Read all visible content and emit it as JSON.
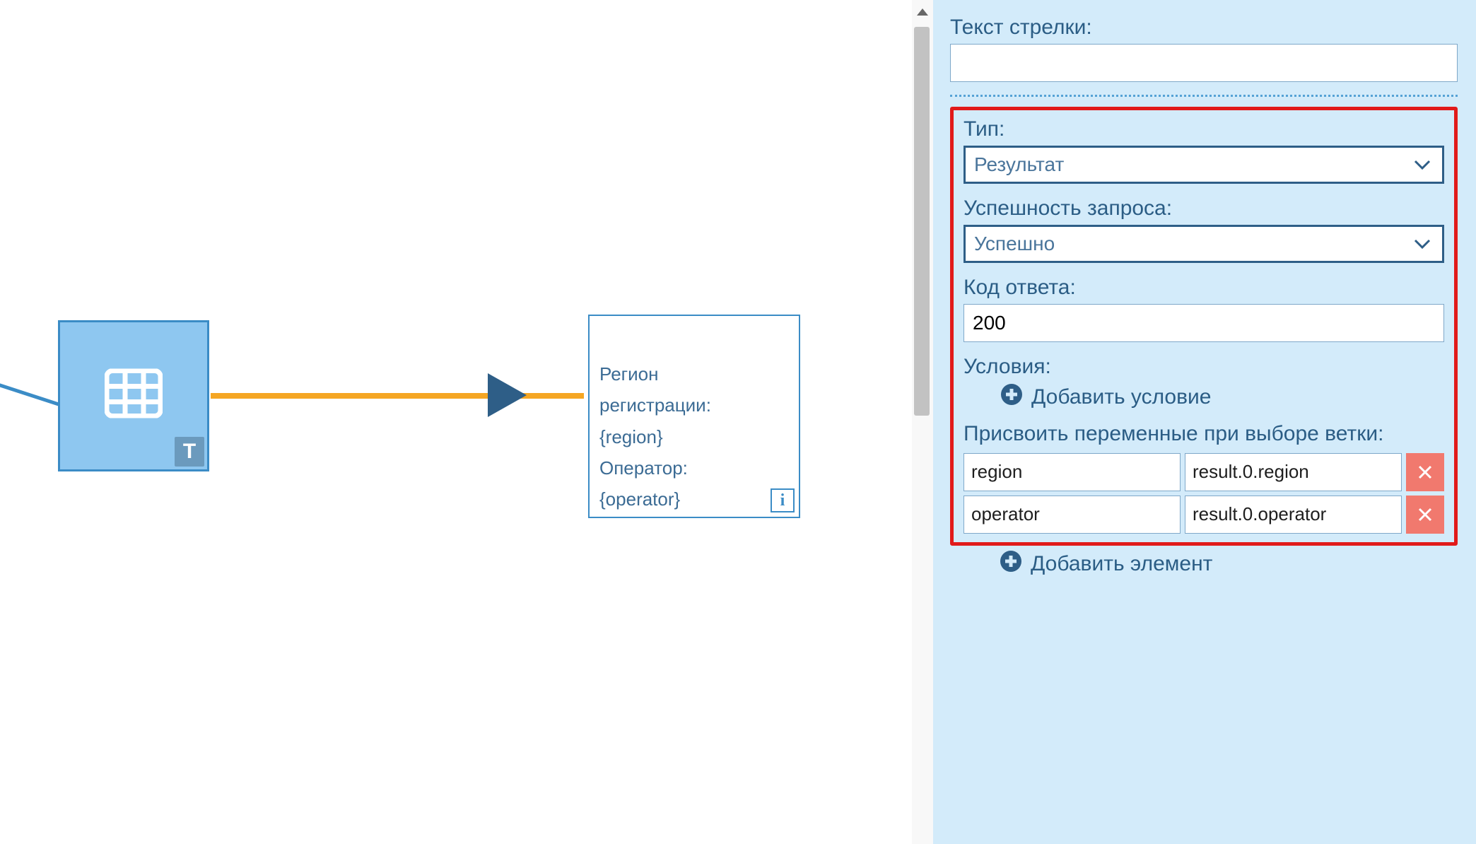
{
  "panel": {
    "arrow_text_label": "Текст стрелки:",
    "arrow_text_value": "",
    "type_label": "Тип:",
    "type_value": "Результат",
    "success_label": "Успешность запроса:",
    "success_value": "Успешно",
    "code_label": "Код ответа:",
    "code_value": "200",
    "conditions_label": "Условия:",
    "add_condition_label": "Добавить условие",
    "assign_vars_label": "Присвоить переменные при выборе ветки:",
    "vars": [
      {
        "name": "region",
        "value": "result.0.region"
      },
      {
        "name": "operator",
        "value": "result.0.operator"
      }
    ],
    "add_element_label": "Добавить элемент"
  },
  "canvas": {
    "source_badge": "T",
    "target_text": "Регион\nрегистрации:\n{region}\nОператор:\n{operator}",
    "target_info": "i"
  },
  "colors": {
    "panel_bg": "#d3ebfa",
    "accent": "#2e5e87",
    "edge": "#f5a623",
    "danger": "#f1796e",
    "highlight": "#e11a1a"
  }
}
